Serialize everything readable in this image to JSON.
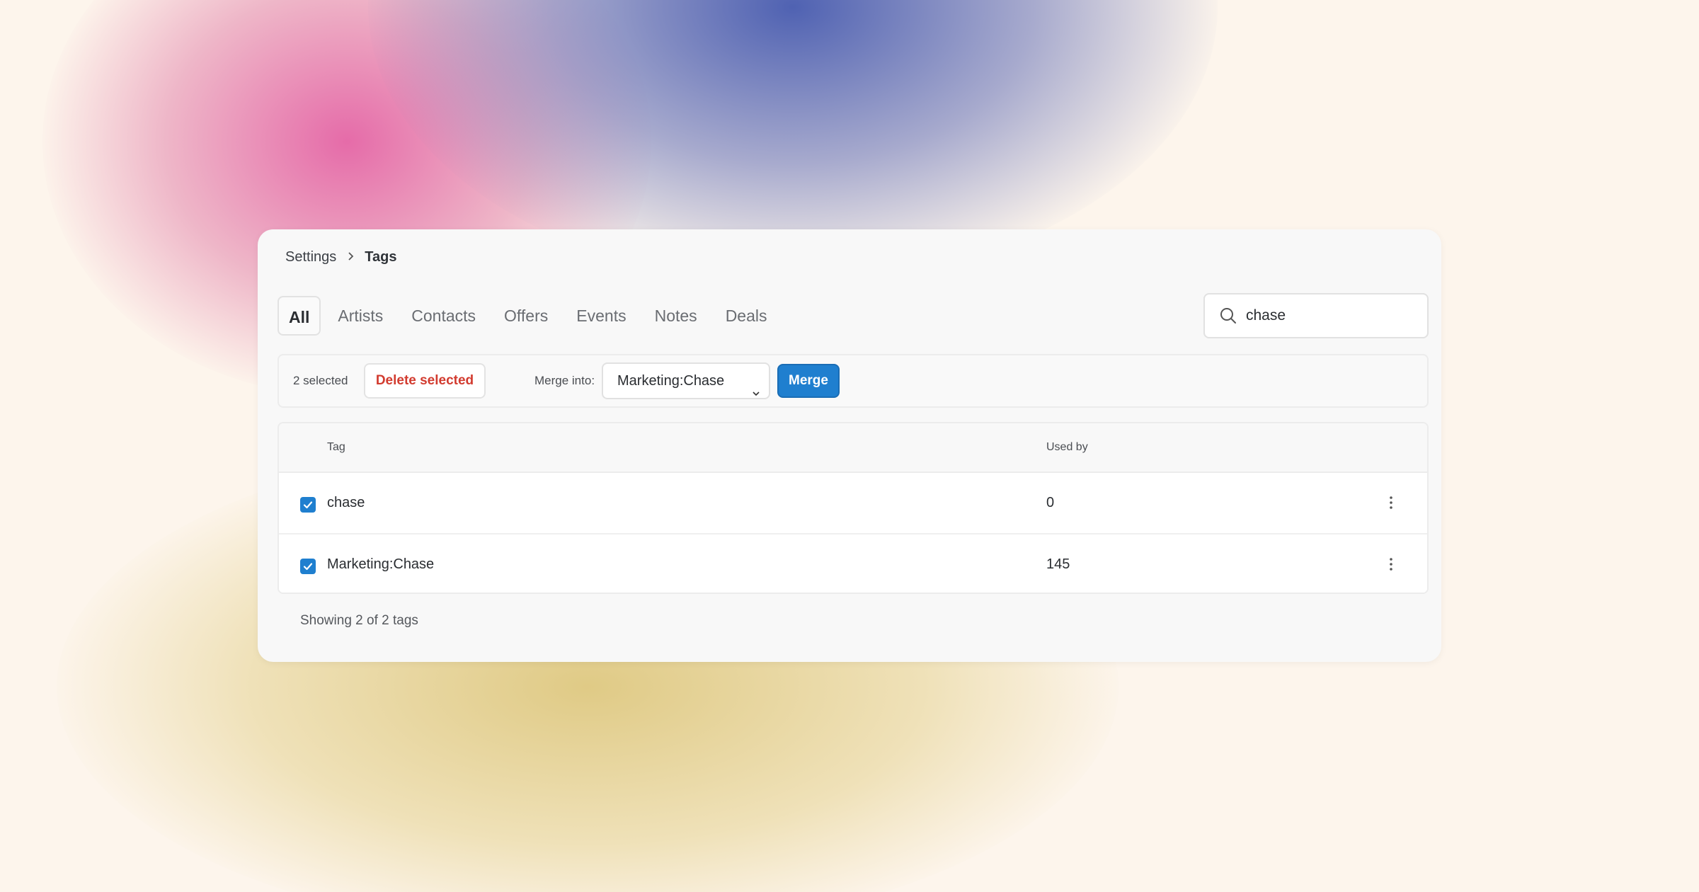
{
  "breadcrumb": {
    "parent": "Settings",
    "current": "Tags"
  },
  "tabs": [
    {
      "label": "All",
      "active": true
    },
    {
      "label": "Artists"
    },
    {
      "label": "Contacts"
    },
    {
      "label": "Offers"
    },
    {
      "label": "Events"
    },
    {
      "label": "Notes"
    },
    {
      "label": "Deals"
    }
  ],
  "search": {
    "value": "chase",
    "icon": "search-icon"
  },
  "actions": {
    "selected_count": "2 selected",
    "delete_label": "Delete selected",
    "merge_label": "Merge into:",
    "merge_target": "Marketing:Chase",
    "merge_button": "Merge"
  },
  "table": {
    "headers": {
      "tag": "Tag",
      "used_by": "Used by"
    },
    "rows": [
      {
        "tag": "chase",
        "used_by": "0",
        "checked": true
      },
      {
        "tag": "Marketing:Chase",
        "used_by": "145",
        "checked": true
      }
    ]
  },
  "footer": {
    "summary": "Showing 2 of 2 tags"
  },
  "colors": {
    "accent": "#1f7fcf",
    "danger": "#d23b2f",
    "card": "#f8f8f8"
  }
}
